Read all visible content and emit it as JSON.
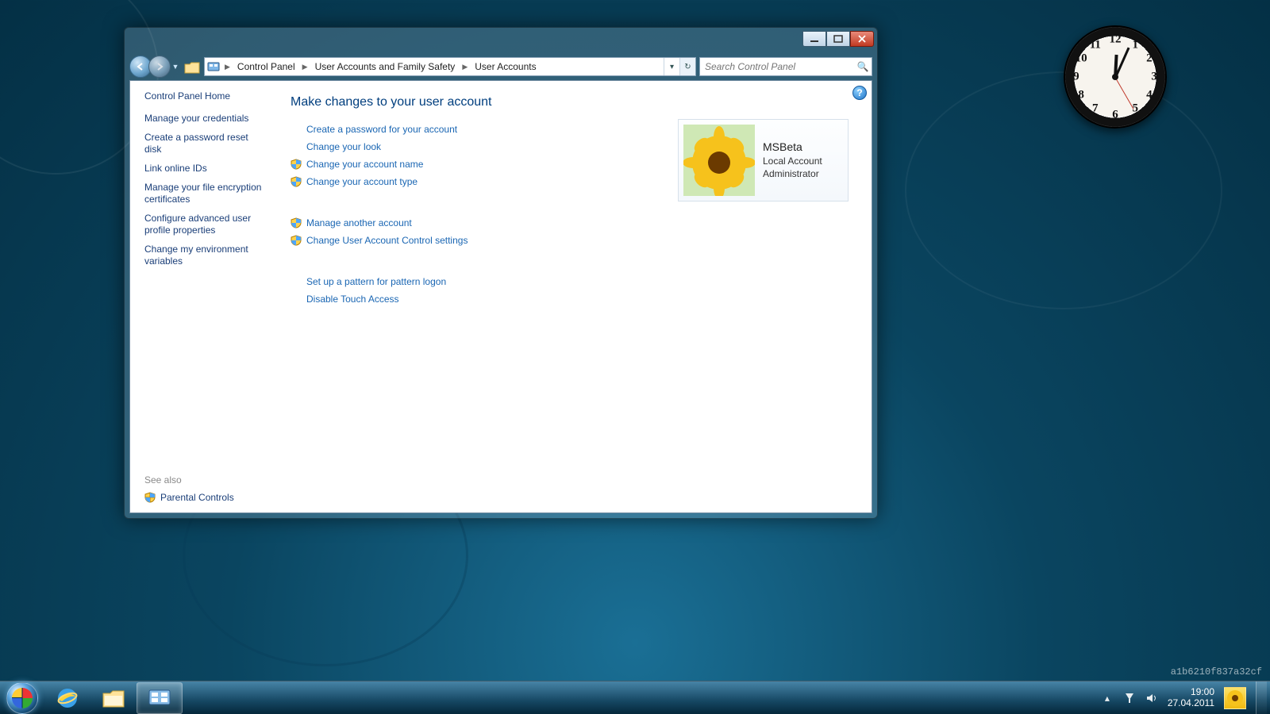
{
  "breadcrumb": {
    "root_icon": "control-panel-icon",
    "item0": "Control Panel",
    "item1": "User Accounts and Family Safety",
    "item2": "User Accounts"
  },
  "search": {
    "placeholder": "Search Control Panel"
  },
  "sidebar": {
    "home": "Control Panel Home",
    "tasks": {
      "t0": "Manage your credentials",
      "t1": "Create a password reset disk",
      "t2": "Link online IDs",
      "t3": "Manage your file encryption certificates",
      "t4": "Configure advanced user profile properties",
      "t5": "Change my environment variables"
    },
    "seealso_label": "See also",
    "seealso_item": "Parental Controls"
  },
  "main": {
    "heading": "Make changes to your user account",
    "links": {
      "l0": "Create a password for your account",
      "l1": "Change your look",
      "l2": "Change your account name",
      "l3": "Change your account type",
      "l4": "Manage another account",
      "l5": "Change User Account Control settings",
      "l6": "Set up a pattern for pattern logon",
      "l7": "Disable Touch Access"
    }
  },
  "account": {
    "name": "MSBeta",
    "type": "Local Account",
    "role": "Administrator"
  },
  "systray": {
    "time": "19:00",
    "date": "27.04.2011"
  },
  "watermark": "a1b6210f837a32cf",
  "clock": {
    "hour": 12,
    "minute": 4,
    "second": 25
  }
}
